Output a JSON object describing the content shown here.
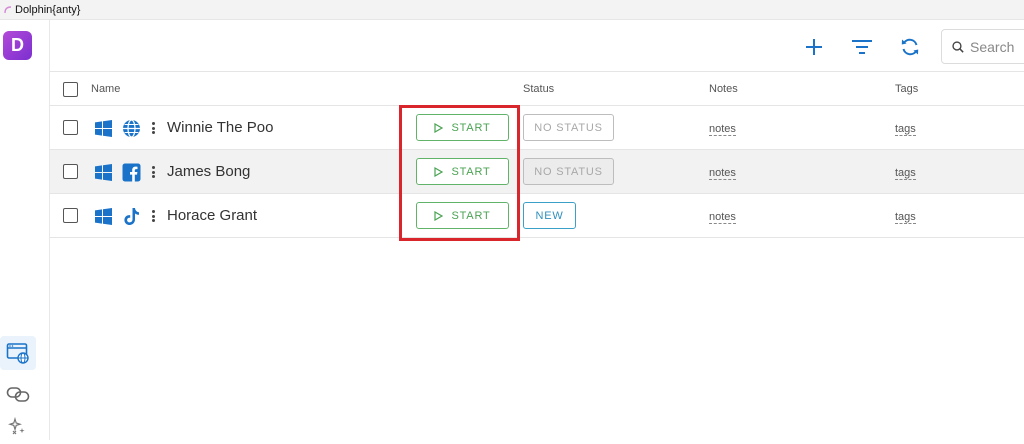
{
  "window": {
    "title": "Dolphin{anty}"
  },
  "app": {
    "logo_letter": "D"
  },
  "toolbar": {
    "add_icon": "plus-icon",
    "filter_icon": "filter-icon",
    "refresh_icon": "refresh-icon"
  },
  "search": {
    "placeholder": "Search"
  },
  "table": {
    "headers": {
      "name": "Name",
      "status": "Status",
      "notes": "Notes",
      "tags": "Tags"
    },
    "rows": [
      {
        "name": "Winnie The Poo",
        "os": "windows-icon",
        "site": "globe-icon",
        "start_label": "START",
        "status": "NO STATUS",
        "notes": "notes",
        "tags": "tags"
      },
      {
        "name": "James Bong",
        "os": "windows-icon",
        "site": "facebook-icon",
        "start_label": "START",
        "status": "NO STATUS",
        "notes": "notes",
        "tags": "tags"
      },
      {
        "name": "Horace Grant",
        "os": "windows-icon",
        "site": "tiktok-icon",
        "start_label": "START",
        "status": "NEW",
        "notes": "notes",
        "tags": "tags"
      }
    ]
  },
  "colors": {
    "accent": "#1a73c9",
    "start_green": "#4aa352",
    "new_status": "#2f8fbd",
    "highlight": "#d9262c",
    "logo": "#9b3ed6"
  }
}
